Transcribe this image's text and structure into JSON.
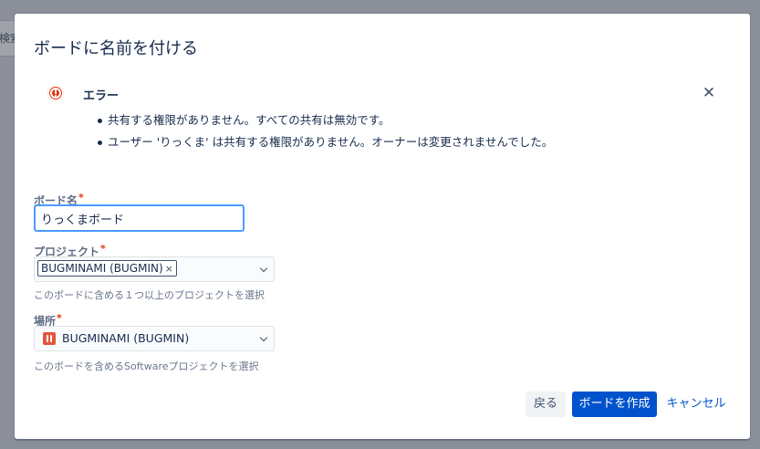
{
  "background": {
    "search_fragment": "検索"
  },
  "dialog": {
    "title": "ボードに名前を付ける",
    "error": {
      "title": "エラー",
      "messages": [
        "共有する権限がありません。すべての共有は無効です。",
        "ユーザー 'りっくま' は共有する権限がありません。オーナーは変更されませんでした。"
      ],
      "close_label": "✕"
    },
    "board_name": {
      "label": "ボード名",
      "required_mark": "*",
      "value": "りっくまボード"
    },
    "project": {
      "label": "プロジェクト",
      "required_mark": "*",
      "selected_chip": "BUGMINAMI (BUGMIN)",
      "chip_remove": "×",
      "help": "このボードに含める１つ以上のプロジェクトを選択"
    },
    "location": {
      "label": "場所",
      "required_mark": "*",
      "value": "BUGMINAMI (BUGMIN)",
      "help": "このボードを含めるSoftwareプロジェクトを選択"
    },
    "buttons": {
      "back": "戻る",
      "create": "ボードを作成",
      "cancel": "キャンセル"
    }
  },
  "colors": {
    "primary": "#0052cc",
    "error": "#de350b",
    "focus": "#4c9aff"
  }
}
